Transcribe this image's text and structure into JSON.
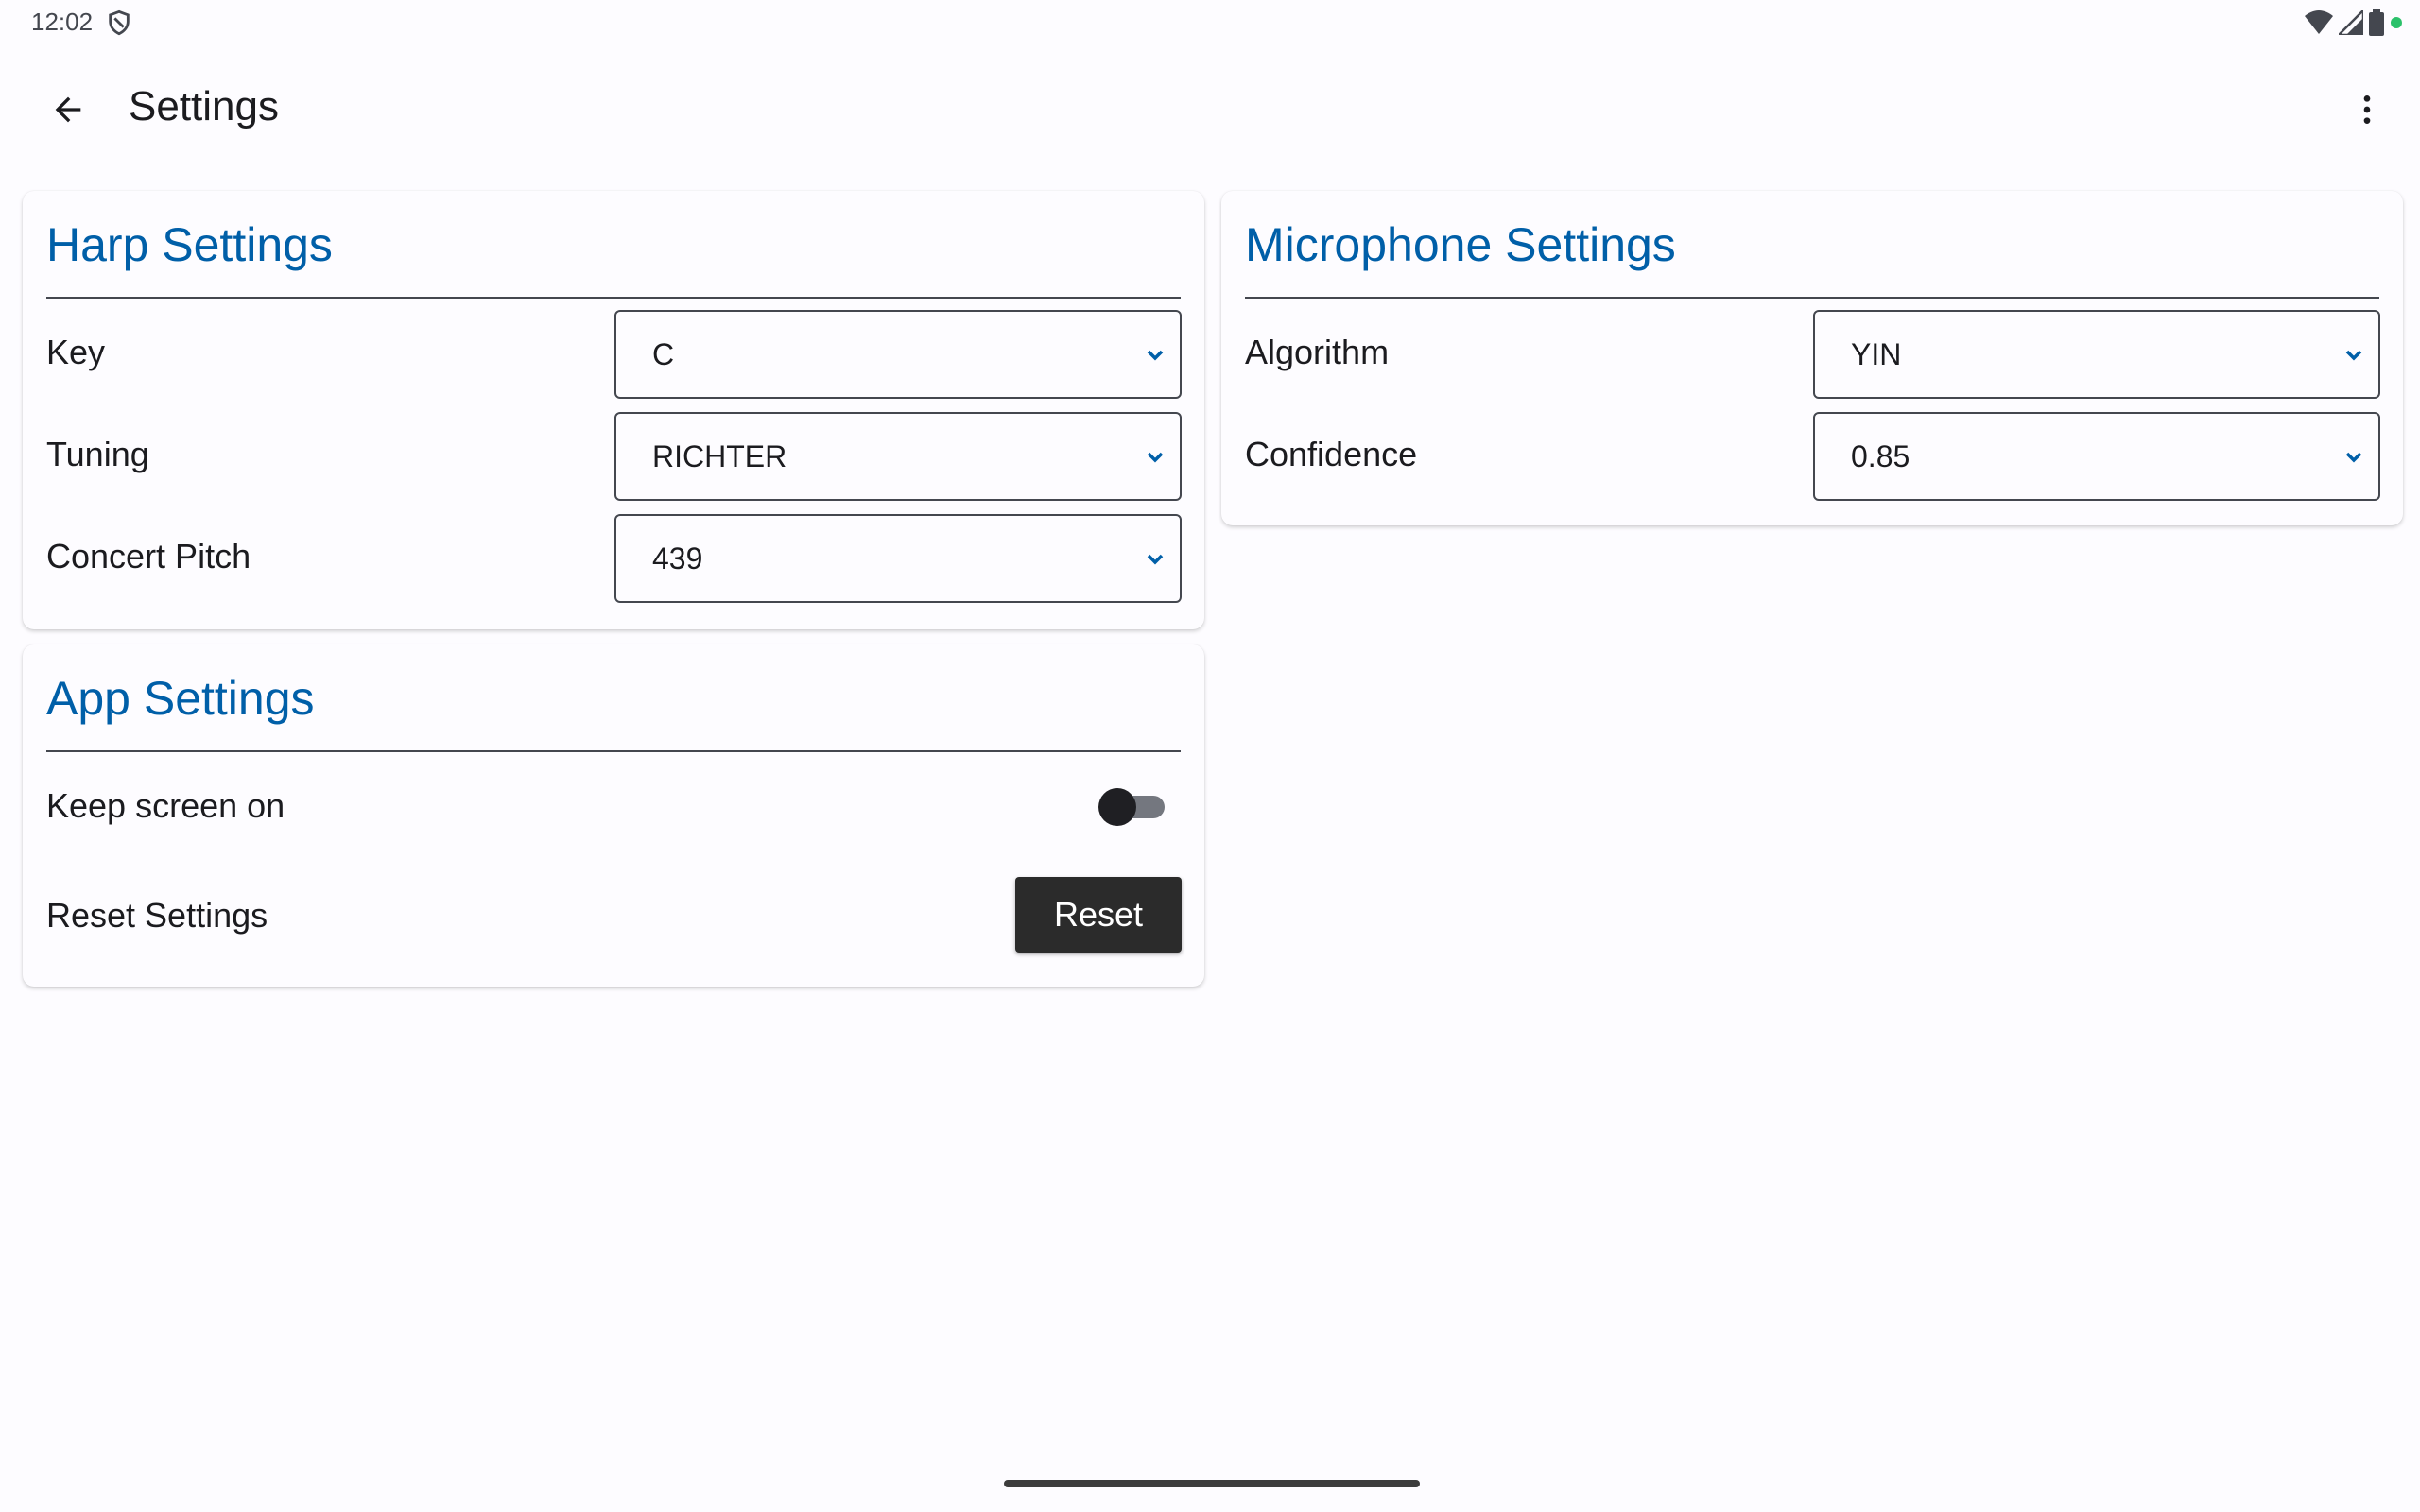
{
  "status_bar": {
    "time": "12:02",
    "icons": [
      "shield-icon",
      "wifi-icon",
      "cellular-signal-icon",
      "battery-icon",
      "privacy-indicator-dot"
    ],
    "indicator_color": "#2BC16A"
  },
  "app_bar": {
    "title": "Settings",
    "back_icon": "arrow-back-icon",
    "menu_icon": "more-vert-icon"
  },
  "harp_settings": {
    "title": "Harp Settings",
    "rows": [
      {
        "label": "Key",
        "value": "C"
      },
      {
        "label": "Tuning",
        "value": "RICHTER"
      },
      {
        "label": "Concert Pitch",
        "value": "439"
      }
    ]
  },
  "microphone_settings": {
    "title": "Microphone Settings",
    "rows": [
      {
        "label": "Algorithm",
        "value": "YIN"
      },
      {
        "label": "Confidence",
        "value": "0.85"
      }
    ]
  },
  "app_settings": {
    "title": "App Settings",
    "keep_screen_on": {
      "label": "Keep screen on",
      "enabled": false
    },
    "reset": {
      "label": "Reset Settings",
      "button_label": "Reset"
    }
  },
  "colors": {
    "accent": "#005FA8",
    "background": "#FDFCFF",
    "reset_button": "#2B2B2B"
  }
}
